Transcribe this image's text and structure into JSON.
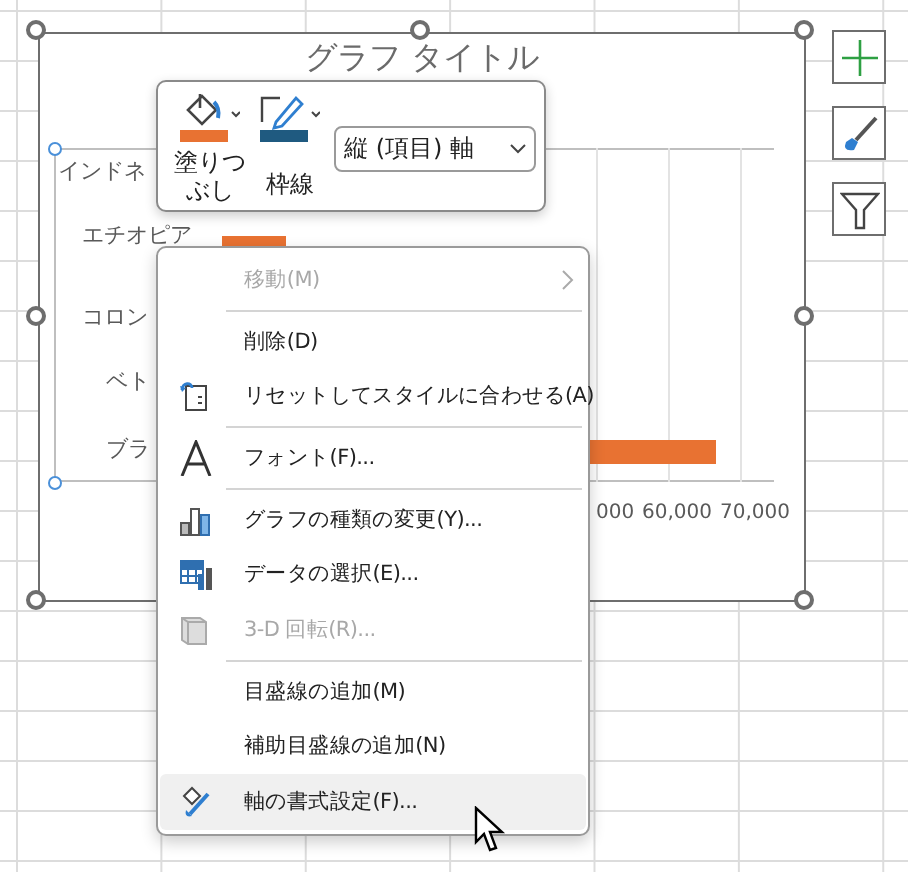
{
  "chart": {
    "title": "グラフ タイトル",
    "categories": [
      "インドネ",
      "エチオピア",
      "コロン",
      "ベト",
      "ブラ"
    ],
    "axis_ticks": [
      "000",
      "60,000",
      "70,000"
    ]
  },
  "mini_toolbar": {
    "buttons": [
      {
        "kind": "fill",
        "label": "塗りつぶし"
      },
      {
        "kind": "outline",
        "label": "枠線"
      }
    ],
    "element_select": {
      "value": "縦 (項目) 軸"
    }
  },
  "context_menu": [
    {
      "label": "移動(M)",
      "kind": "none",
      "disabled": true,
      "submenu": true,
      "separator_after": true,
      "selected": false
    },
    {
      "label": "削除(D)",
      "kind": "none",
      "disabled": false,
      "submenu": false,
      "separator_after": false,
      "selected": false
    },
    {
      "label": "リセットしてスタイルに合わせる(A)",
      "kind": "reset",
      "disabled": false,
      "submenu": false,
      "separator_after": true,
      "selected": false
    },
    {
      "label": "フォント(F)...",
      "kind": "font",
      "disabled": false,
      "submenu": false,
      "separator_after": true,
      "selected": false
    },
    {
      "label": "グラフの種類の変更(Y)...",
      "kind": "chart-type",
      "disabled": false,
      "submenu": false,
      "separator_after": false,
      "selected": false
    },
    {
      "label": "データの選択(E)...",
      "kind": "data",
      "disabled": false,
      "submenu": false,
      "separator_after": false,
      "selected": false
    },
    {
      "label": "3-D 回転(R)...",
      "kind": "rotate3d",
      "disabled": true,
      "submenu": false,
      "separator_after": true,
      "selected": false
    },
    {
      "label": "目盛線の追加(M)",
      "kind": "none",
      "disabled": false,
      "submenu": false,
      "separator_after": false,
      "selected": false
    },
    {
      "label": "補助目盛線の追加(N)",
      "kind": "none",
      "disabled": false,
      "submenu": false,
      "separator_after": false,
      "selected": false
    },
    {
      "label": "軸の書式設定(F)...",
      "kind": "format",
      "disabled": false,
      "submenu": false,
      "separator_after": false,
      "selected": true
    }
  ]
}
